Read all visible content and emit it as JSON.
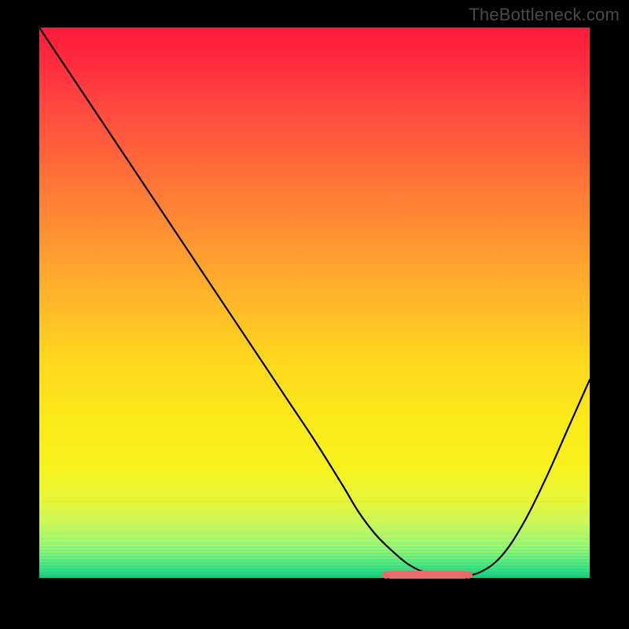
{
  "watermark": "TheBottleneck.com",
  "chart_data": {
    "type": "line",
    "title": "",
    "xlabel": "",
    "ylabel": "",
    "xlim": [
      0,
      100
    ],
    "ylim": [
      0,
      100
    ],
    "grid": false,
    "series": [
      {
        "name": "curve",
        "color": "#000000",
        "x": [
          0,
          5,
          10,
          15,
          20,
          25,
          30,
          35,
          40,
          45,
          50,
          55,
          58,
          61,
          64,
          67,
          70,
          73,
          76,
          80,
          84,
          88,
          92,
          96,
          100
        ],
        "y": [
          100,
          92.5,
          85,
          77.5,
          70,
          62.5,
          55,
          47.5,
          40,
          32.5,
          25,
          17,
          12,
          8,
          5,
          2.5,
          1,
          0.3,
          0.3,
          1,
          4,
          10,
          18,
          27,
          36
        ]
      }
    ],
    "highlight": {
      "name": "bottleneck-band",
      "color": "#e86a6a",
      "x_start": 63,
      "x_end": 78,
      "y": 0
    },
    "background_gradient": {
      "top": "#ff1a3a",
      "mid": "#ffe61e",
      "bottom": "#12c87a"
    }
  }
}
